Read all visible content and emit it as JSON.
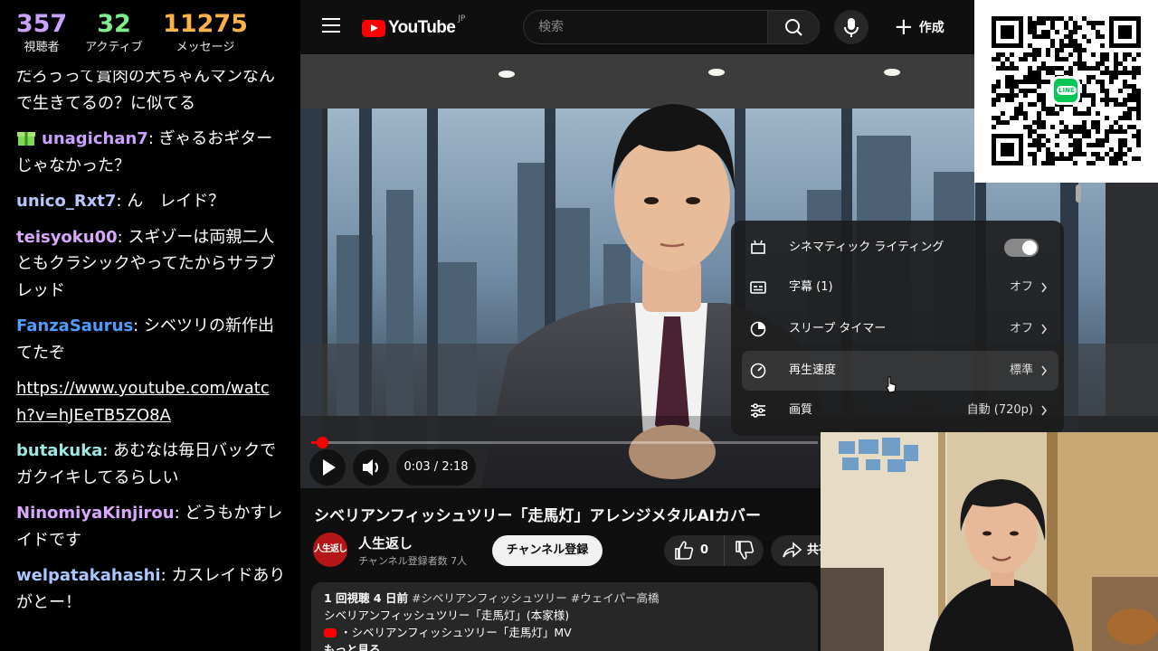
{
  "stats": {
    "viewers_value": "357",
    "viewers_label": "視聴者",
    "active_value": "32",
    "active_label": "アクティブ",
    "messages_value": "11275",
    "messages_label": "メッセージ"
  },
  "chat": [
    {
      "user": "",
      "text": "だろうって賞肉の犬ちゃんマンなんで生きてるの？に似てる",
      "color": "#ffffff"
    },
    {
      "user": "unagichan7",
      "text": "ぎゃるおギターじゃなかった？",
      "color": "#c9a2ff",
      "badge": "gift-icon"
    },
    {
      "user": "unico_Rxt7",
      "text": "ん　レイド？",
      "color": "#b8c6ff"
    },
    {
      "user": "teisyoku00",
      "text": "スギゾーは両親二人ともクラシックやってたからサラブレッド",
      "color": "#d8a9ff"
    },
    {
      "user": "FanzaSaurus",
      "text": "シベツリの新作出てたぞ",
      "color": "#4c9dff"
    },
    {
      "user": "",
      "text": "https://www.youtube.com/watch?v=hJEeTB5ZO8A",
      "color": "#ffffff",
      "link": true
    },
    {
      "user": "butakuka",
      "text": "あむなは毎日バックでガクイキしてるらしい",
      "color": "#9fe8e2"
    },
    {
      "user": "NinomiyaKinjirou",
      "text": "どうもかすレイドです",
      "color": "#d8a9ff"
    },
    {
      "user": "welpatakahashi",
      "text": "カスレイドありがとー！",
      "color": "#a9c6ff"
    }
  ],
  "header": {
    "logo_text": "YouTube",
    "logo_region": "JP",
    "search_placeholder": "検索",
    "create_label": "作成",
    "icons": [
      "menu-icon",
      "search-icon",
      "mic-icon",
      "plus-icon"
    ]
  },
  "player": {
    "time": "0:03 / 2:18",
    "progress": 0.0217,
    "icons": [
      "play-icon",
      "volume-icon"
    ]
  },
  "settings": {
    "rows": [
      {
        "label": "シネマティック ライティング",
        "value": "",
        "toggle": true,
        "icon": "cinematic-icon"
      },
      {
        "label": "字幕 (1)",
        "value": "オフ",
        "icon": "subtitles-icon"
      },
      {
        "label": "スリープ タイマー",
        "value": "オフ",
        "icon": "sleep-timer-icon"
      },
      {
        "label": "再生速度",
        "value": "標準",
        "icon": "speed-icon",
        "highlight": true
      },
      {
        "label": "画質",
        "value": "自動 (720p)",
        "icon": "quality-icon"
      }
    ]
  },
  "video": {
    "title": "シベリアンフィッシュツリー「走馬灯」アレンジメタルAIカバー",
    "channel_name": "人生返し",
    "channel_avatar_text": "人生返し",
    "subscribers": "チャンネル登録者数 7人",
    "subscribe_label": "チャンネル登録",
    "like_count": "0",
    "share_label": "共有",
    "description": {
      "meta": "1 回視聴  4 日前",
      "tags": "#シベリアンフィッシュツリー #ウェイパー高橋",
      "line1": "シベリアンフィッシュツリー「走馬灯」(本家様)",
      "line2": "・シベリアンフィッシュツリー「走馬灯」MV",
      "more": "もっと見る"
    }
  },
  "overlay": {
    "qr_badge_text": "LINE"
  },
  "colors": {
    "accent_red": "#ff0000",
    "line_green": "#06c755",
    "yt_bg": "#0f0f0f"
  }
}
